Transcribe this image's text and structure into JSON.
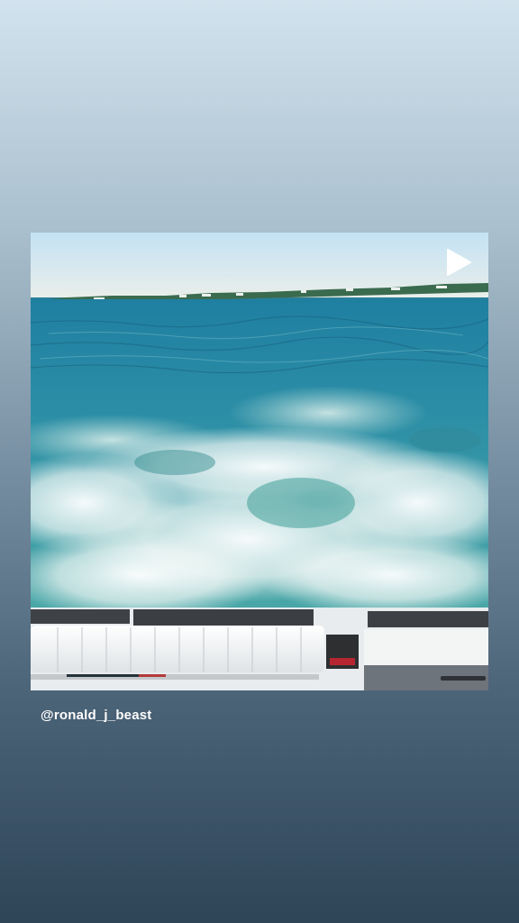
{
  "post": {
    "username": "@ronald_j_beast",
    "media_type": "video",
    "play_icon": "play-icon"
  },
  "colors": {
    "background_top": "#d2e3ee",
    "background_bottom": "#2e4558",
    "username_text": "#ffffff"
  }
}
